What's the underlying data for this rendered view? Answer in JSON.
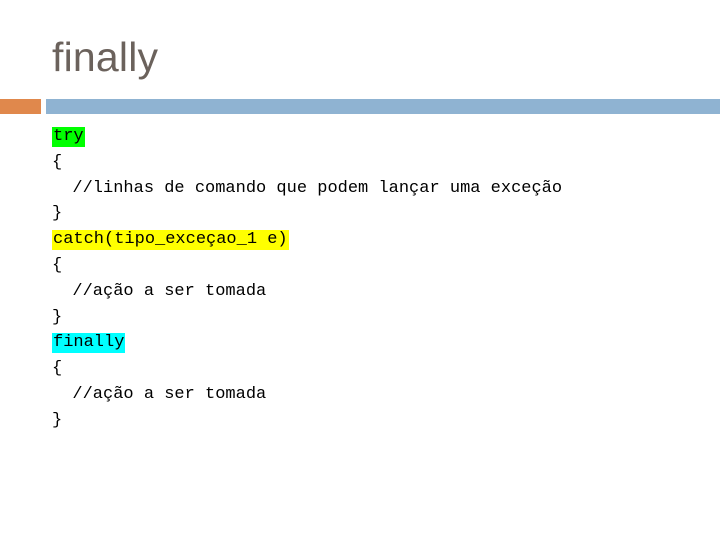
{
  "slide": {
    "title": "finally",
    "title_color": "#6B625C",
    "background_color": "#FFFFFF",
    "divider": {
      "accent_color": "#E0884C",
      "bar_color": "#8FB3D2"
    },
    "code": {
      "lines": [
        {
          "text": "try",
          "highlight": "green"
        },
        {
          "text": "{",
          "highlight": "none"
        },
        {
          "text": "  //linhas de comando que podem lançar uma exceção",
          "highlight": "none"
        },
        {
          "text": "}",
          "highlight": "none"
        },
        {
          "text": "catch(tipo_exceçao_1 e)",
          "highlight": "yellow"
        },
        {
          "text": "{",
          "highlight": "none"
        },
        {
          "text": "  //ação a ser tomada",
          "highlight": "none"
        },
        {
          "text": "}",
          "highlight": "none"
        },
        {
          "text": "finally",
          "highlight": "cyan"
        },
        {
          "text": "{",
          "highlight": "none"
        },
        {
          "text": "  //ação a ser tomada",
          "highlight": "none"
        },
        {
          "text": "}",
          "highlight": "none"
        }
      ],
      "highlight_colors": {
        "green": "#00FF00",
        "yellow": "#FFFF00",
        "cyan": "#00FFFF"
      }
    }
  }
}
